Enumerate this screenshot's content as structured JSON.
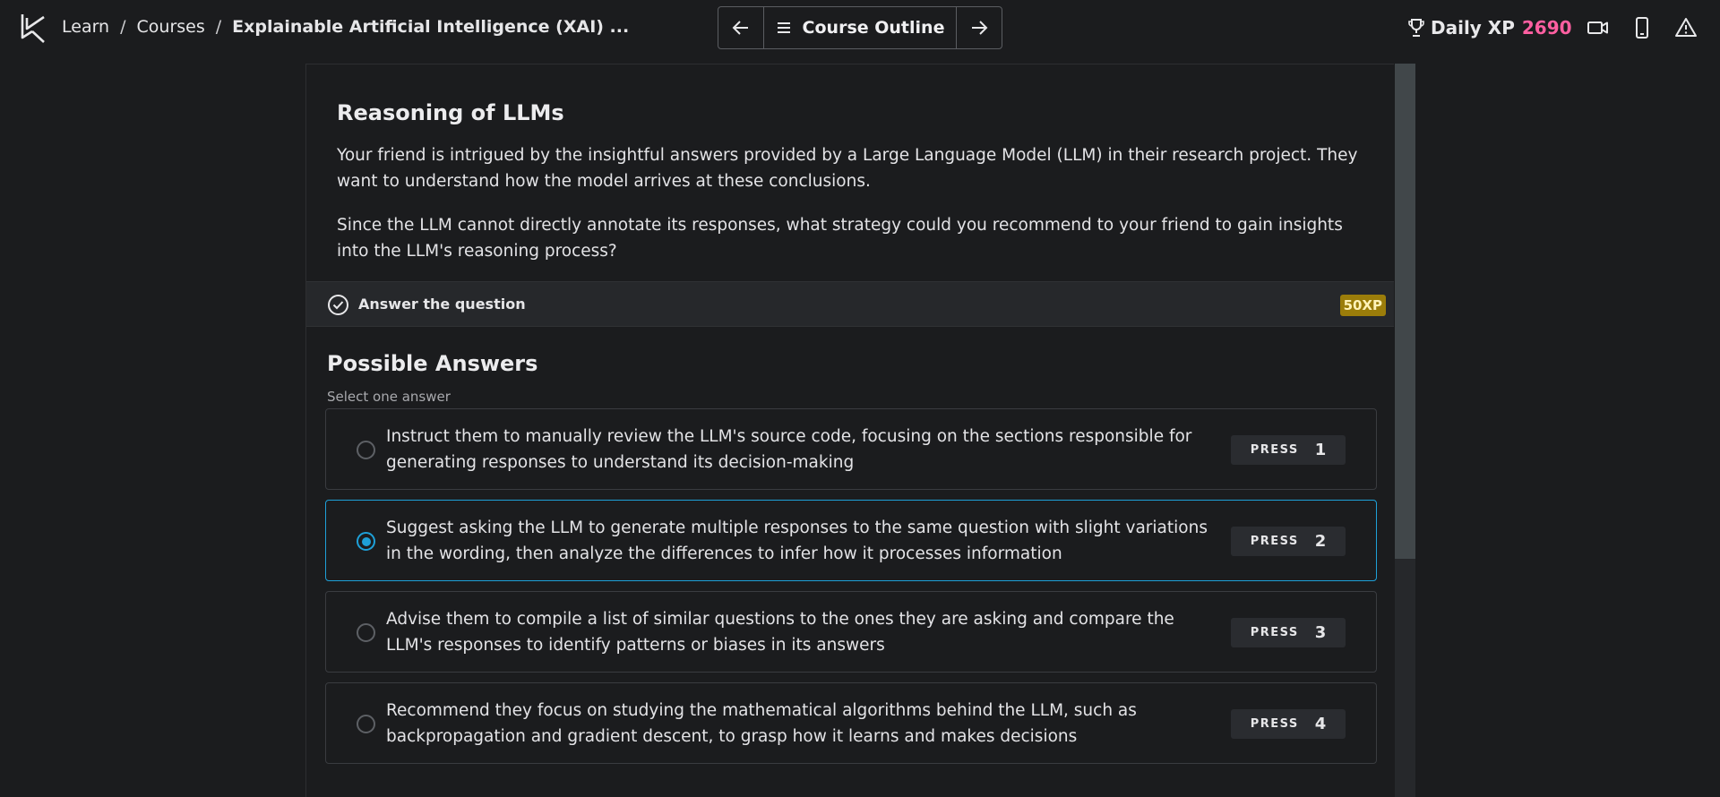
{
  "breadcrumb": {
    "items": [
      "Learn",
      "Courses",
      "Explainable Artificial Intelligence (XAI) ..."
    ],
    "separator": "/"
  },
  "nav": {
    "prev_icon": "arrow-left-icon",
    "outline_label": "Course Outline",
    "outline_icon": "menu-icon",
    "next_icon": "arrow-right-icon"
  },
  "header": {
    "xp_label": "Daily XP",
    "xp_value": "2690",
    "icons": [
      "trophy-icon",
      "video-icon",
      "mobile-icon",
      "alert-icon"
    ]
  },
  "exercise": {
    "title": "Reasoning of LLMs",
    "paragraph1": "Your friend is intrigued by the insightful answers provided by a Large Language Model (LLM) in their research project. They want to understand how the model arrives at these conclusions.",
    "paragraph2": "Since the LLM cannot directly annotate its responses, what strategy could you recommend to your friend to gain insights into the LLM's reasoning process?"
  },
  "instruction": {
    "label": "Answer the question",
    "xp": "50XP"
  },
  "answers": {
    "heading": "Possible Answers",
    "subheading": "Select one answer",
    "press_label": "PRESS",
    "selected_index": 1,
    "options": [
      {
        "text": "Instruct them to manually review the LLM's source code, focusing on the sections responsible for generating responses to understand its decision-making",
        "key": "1"
      },
      {
        "text": "Suggest asking the LLM to generate multiple responses to the same question with slight variations in the wording, then analyze the differences to infer how it processes information",
        "key": "2"
      },
      {
        "text": "Advise them to compile a list of similar questions to the ones they are asking and compare the LLM's responses to identify patterns or biases in its answers",
        "key": "3"
      },
      {
        "text": "Recommend they focus on studying the mathematical algorithms behind the LLM, such as backpropagation and gradient descent, to grasp how it learns and makes decisions",
        "key": "4"
      }
    ]
  },
  "colors": {
    "background": "#1b1c1e",
    "accent_selected": "#1ea0d8",
    "xp_value": "#ff5fa1",
    "xp_badge": "#9b7d0a"
  }
}
